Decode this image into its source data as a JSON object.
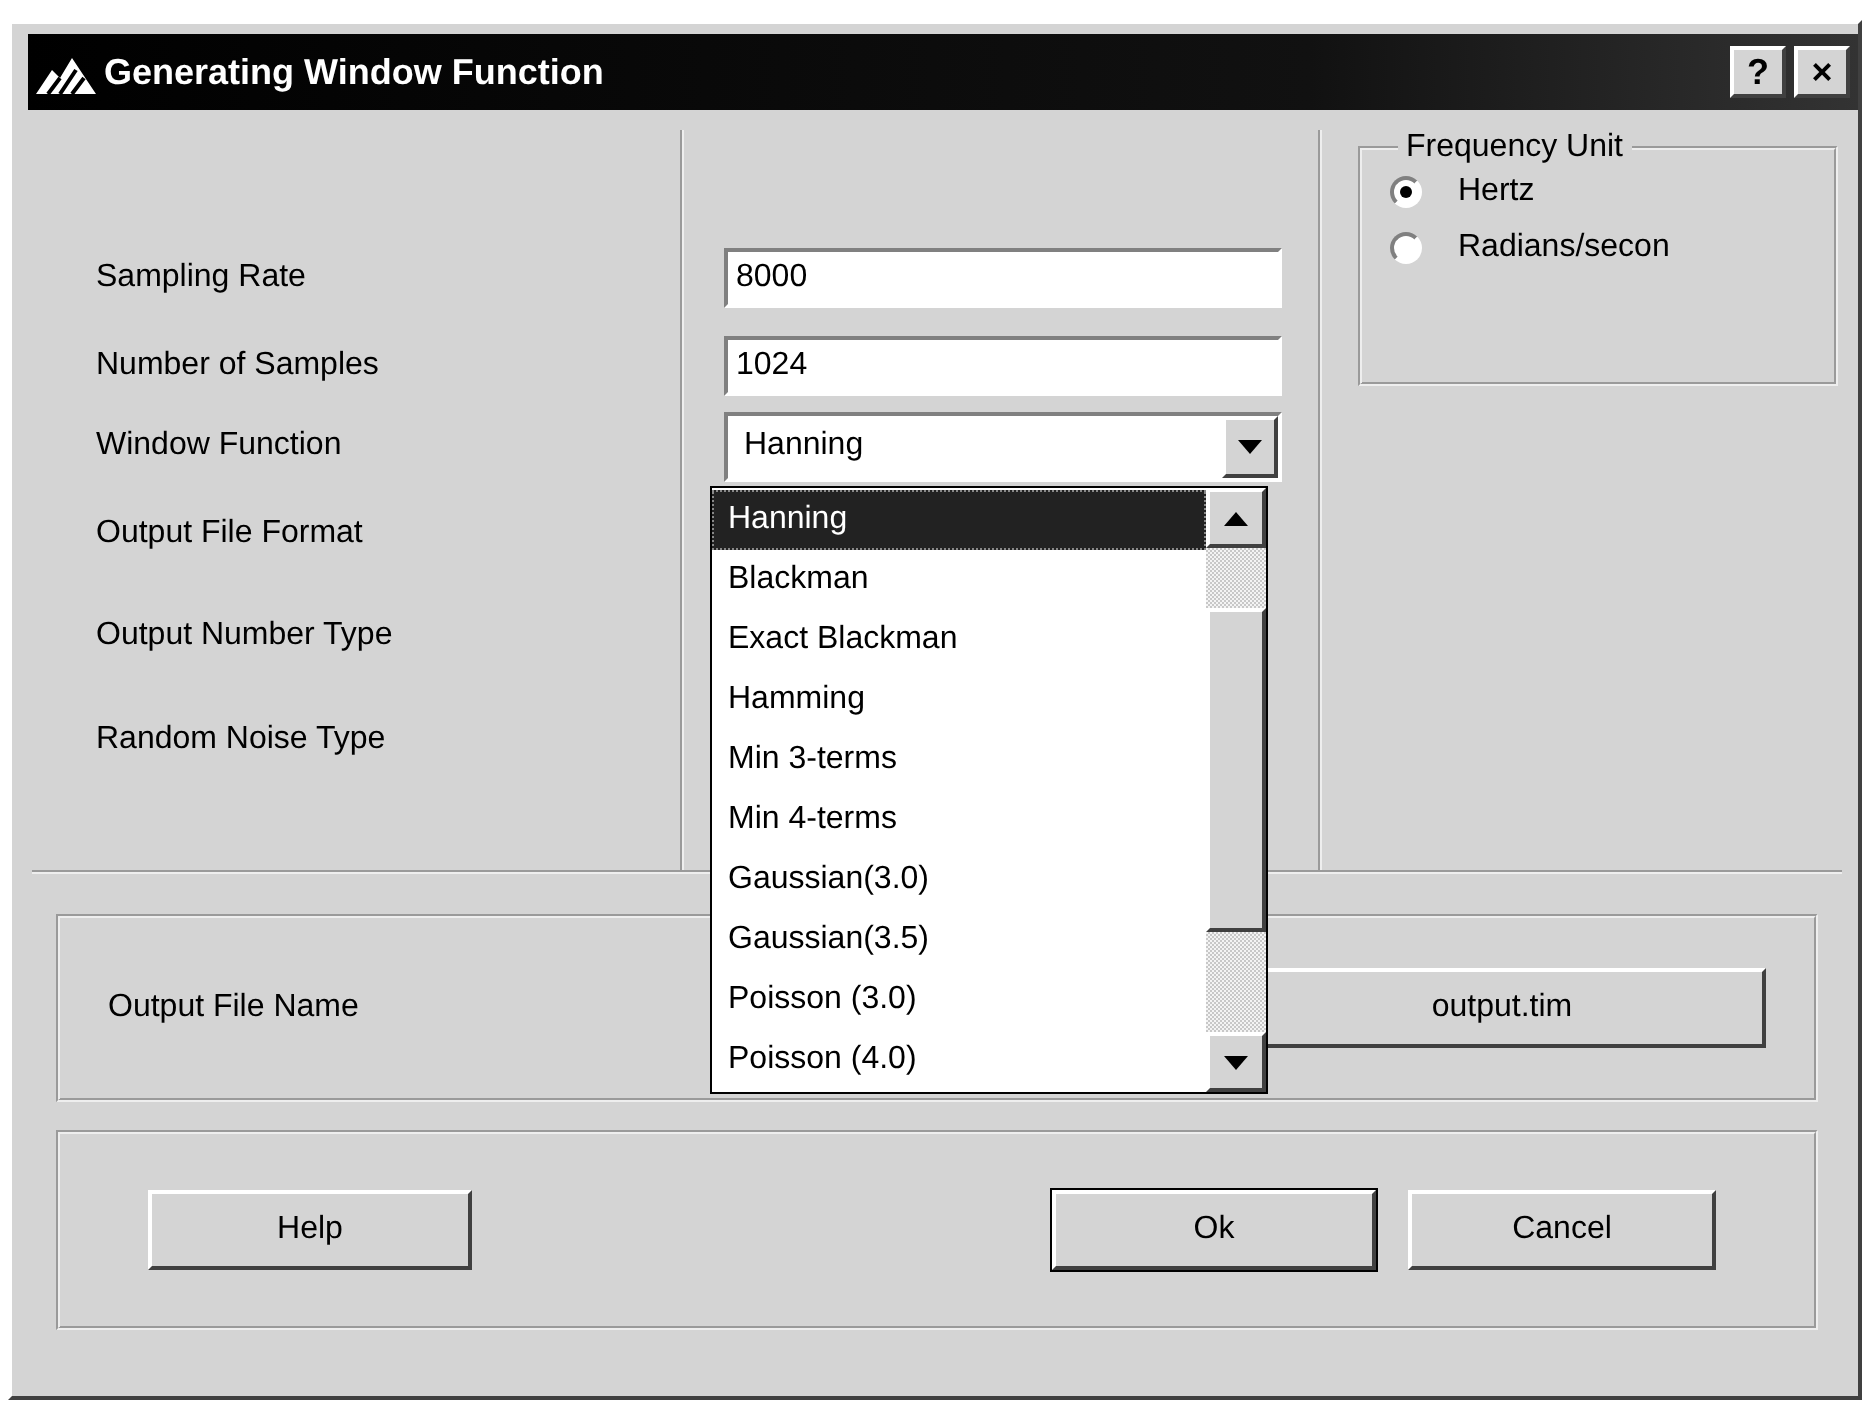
{
  "window": {
    "title": "Generating Window Function",
    "buttons": [
      "?",
      "×"
    ]
  },
  "fields": [
    {
      "label": "Sampling Rate",
      "kind": "text",
      "value": "8000"
    },
    {
      "label": "Number of Samples",
      "kind": "text",
      "value": "1024"
    },
    {
      "label": "Window Function",
      "kind": "combo",
      "value": "Hanning"
    },
    {
      "label": "Output File Format",
      "kind": "covered"
    },
    {
      "label": "Output Number Type",
      "kind": "covered"
    },
    {
      "label": "Random Noise Type",
      "kind": "covered"
    }
  ],
  "frequency_unit": {
    "title": "Frequency Unit",
    "options": [
      {
        "label": "Hertz",
        "selected": true
      },
      {
        "label": "Radians/secon",
        "selected": false
      }
    ]
  },
  "dropdown": {
    "items": [
      {
        "label": "Hanning",
        "selected": true
      },
      {
        "label": "Blackman",
        "selected": false
      },
      {
        "label": "Exact Blackman",
        "selected": false
      },
      {
        "label": "Hamming",
        "selected": false
      },
      {
        "label": "Min 3-terms",
        "selected": false
      },
      {
        "label": "Min 4-terms",
        "selected": false
      },
      {
        "label": "Gaussian(3.0)",
        "selected": false
      },
      {
        "label": "Gaussian(3.5)",
        "selected": false
      },
      {
        "label": "Poisson (3.0)",
        "selected": false
      },
      {
        "label": "Poisson (4.0)",
        "selected": false
      }
    ]
  },
  "output_file": {
    "label": "Output File Name",
    "value": "output.tim"
  },
  "buttons": [
    "Help",
    "Ok",
    "Cancel"
  ]
}
